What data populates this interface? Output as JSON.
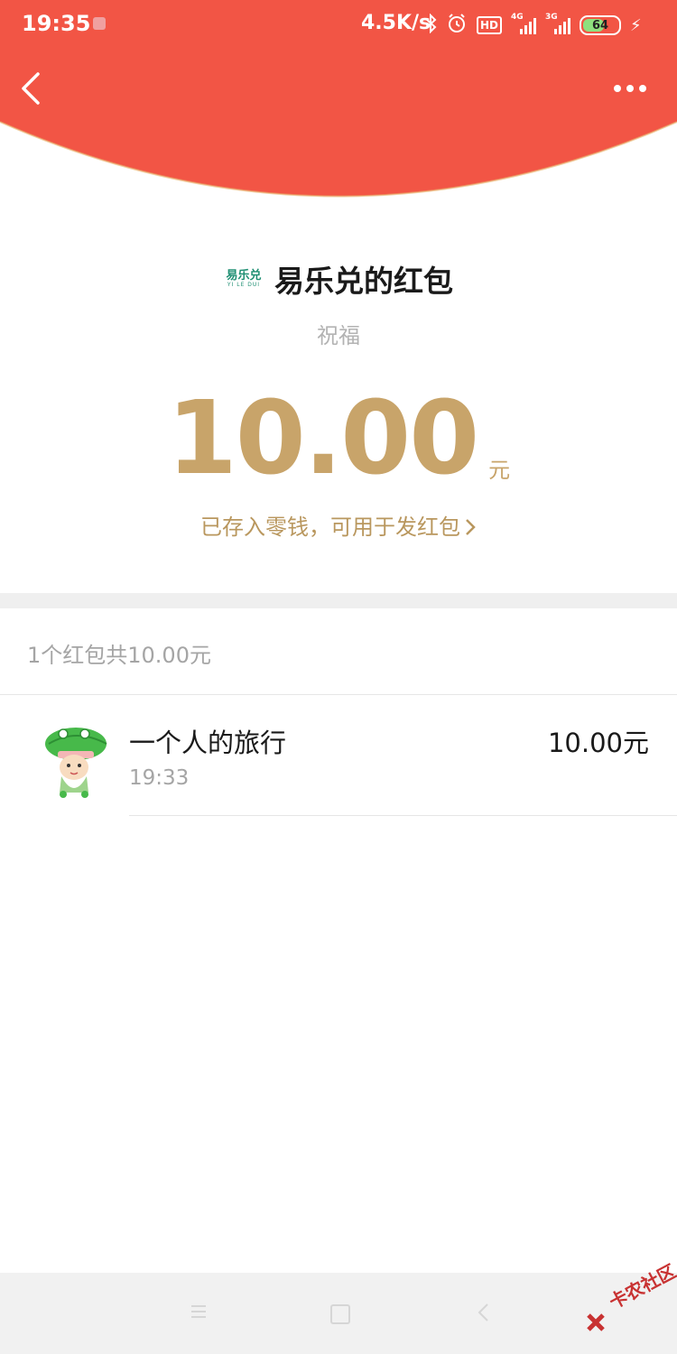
{
  "status_bar": {
    "time": "19:35",
    "network_speed": "4.5K/s",
    "hd_label": "HD",
    "signal1_label": "4G",
    "signal2_label": "3G",
    "battery": "64",
    "battery_fill_percent": 64,
    "icons": [
      "music-notification-icon",
      "bluetooth-icon",
      "alarm-icon",
      "hd-icon",
      "signal-4g-icon",
      "signal-3g-icon",
      "battery-icon",
      "charging-icon"
    ]
  },
  "header": {
    "color": "#f25545",
    "back_icon": "chevron-left-icon",
    "more_icon": "more-dots-icon"
  },
  "envelope": {
    "sender_logo_text": "易乐兑",
    "sender_logo_sub": "YI LE DUI",
    "title": "易乐兑的红包",
    "blessing": "祝福",
    "amount": "10.00",
    "unit": "元",
    "wallet_link": "已存入零钱，可用于发红包",
    "accent_color": "#c8a46a"
  },
  "summary": "1个红包共10.00元",
  "records": [
    {
      "name": "一个人的旅行",
      "time": "19:33",
      "amount": "10.00元"
    }
  ],
  "nav_bar": {
    "icons": [
      "menu-icon",
      "home-icon",
      "back-icon"
    ]
  },
  "watermark": "卡农社区"
}
